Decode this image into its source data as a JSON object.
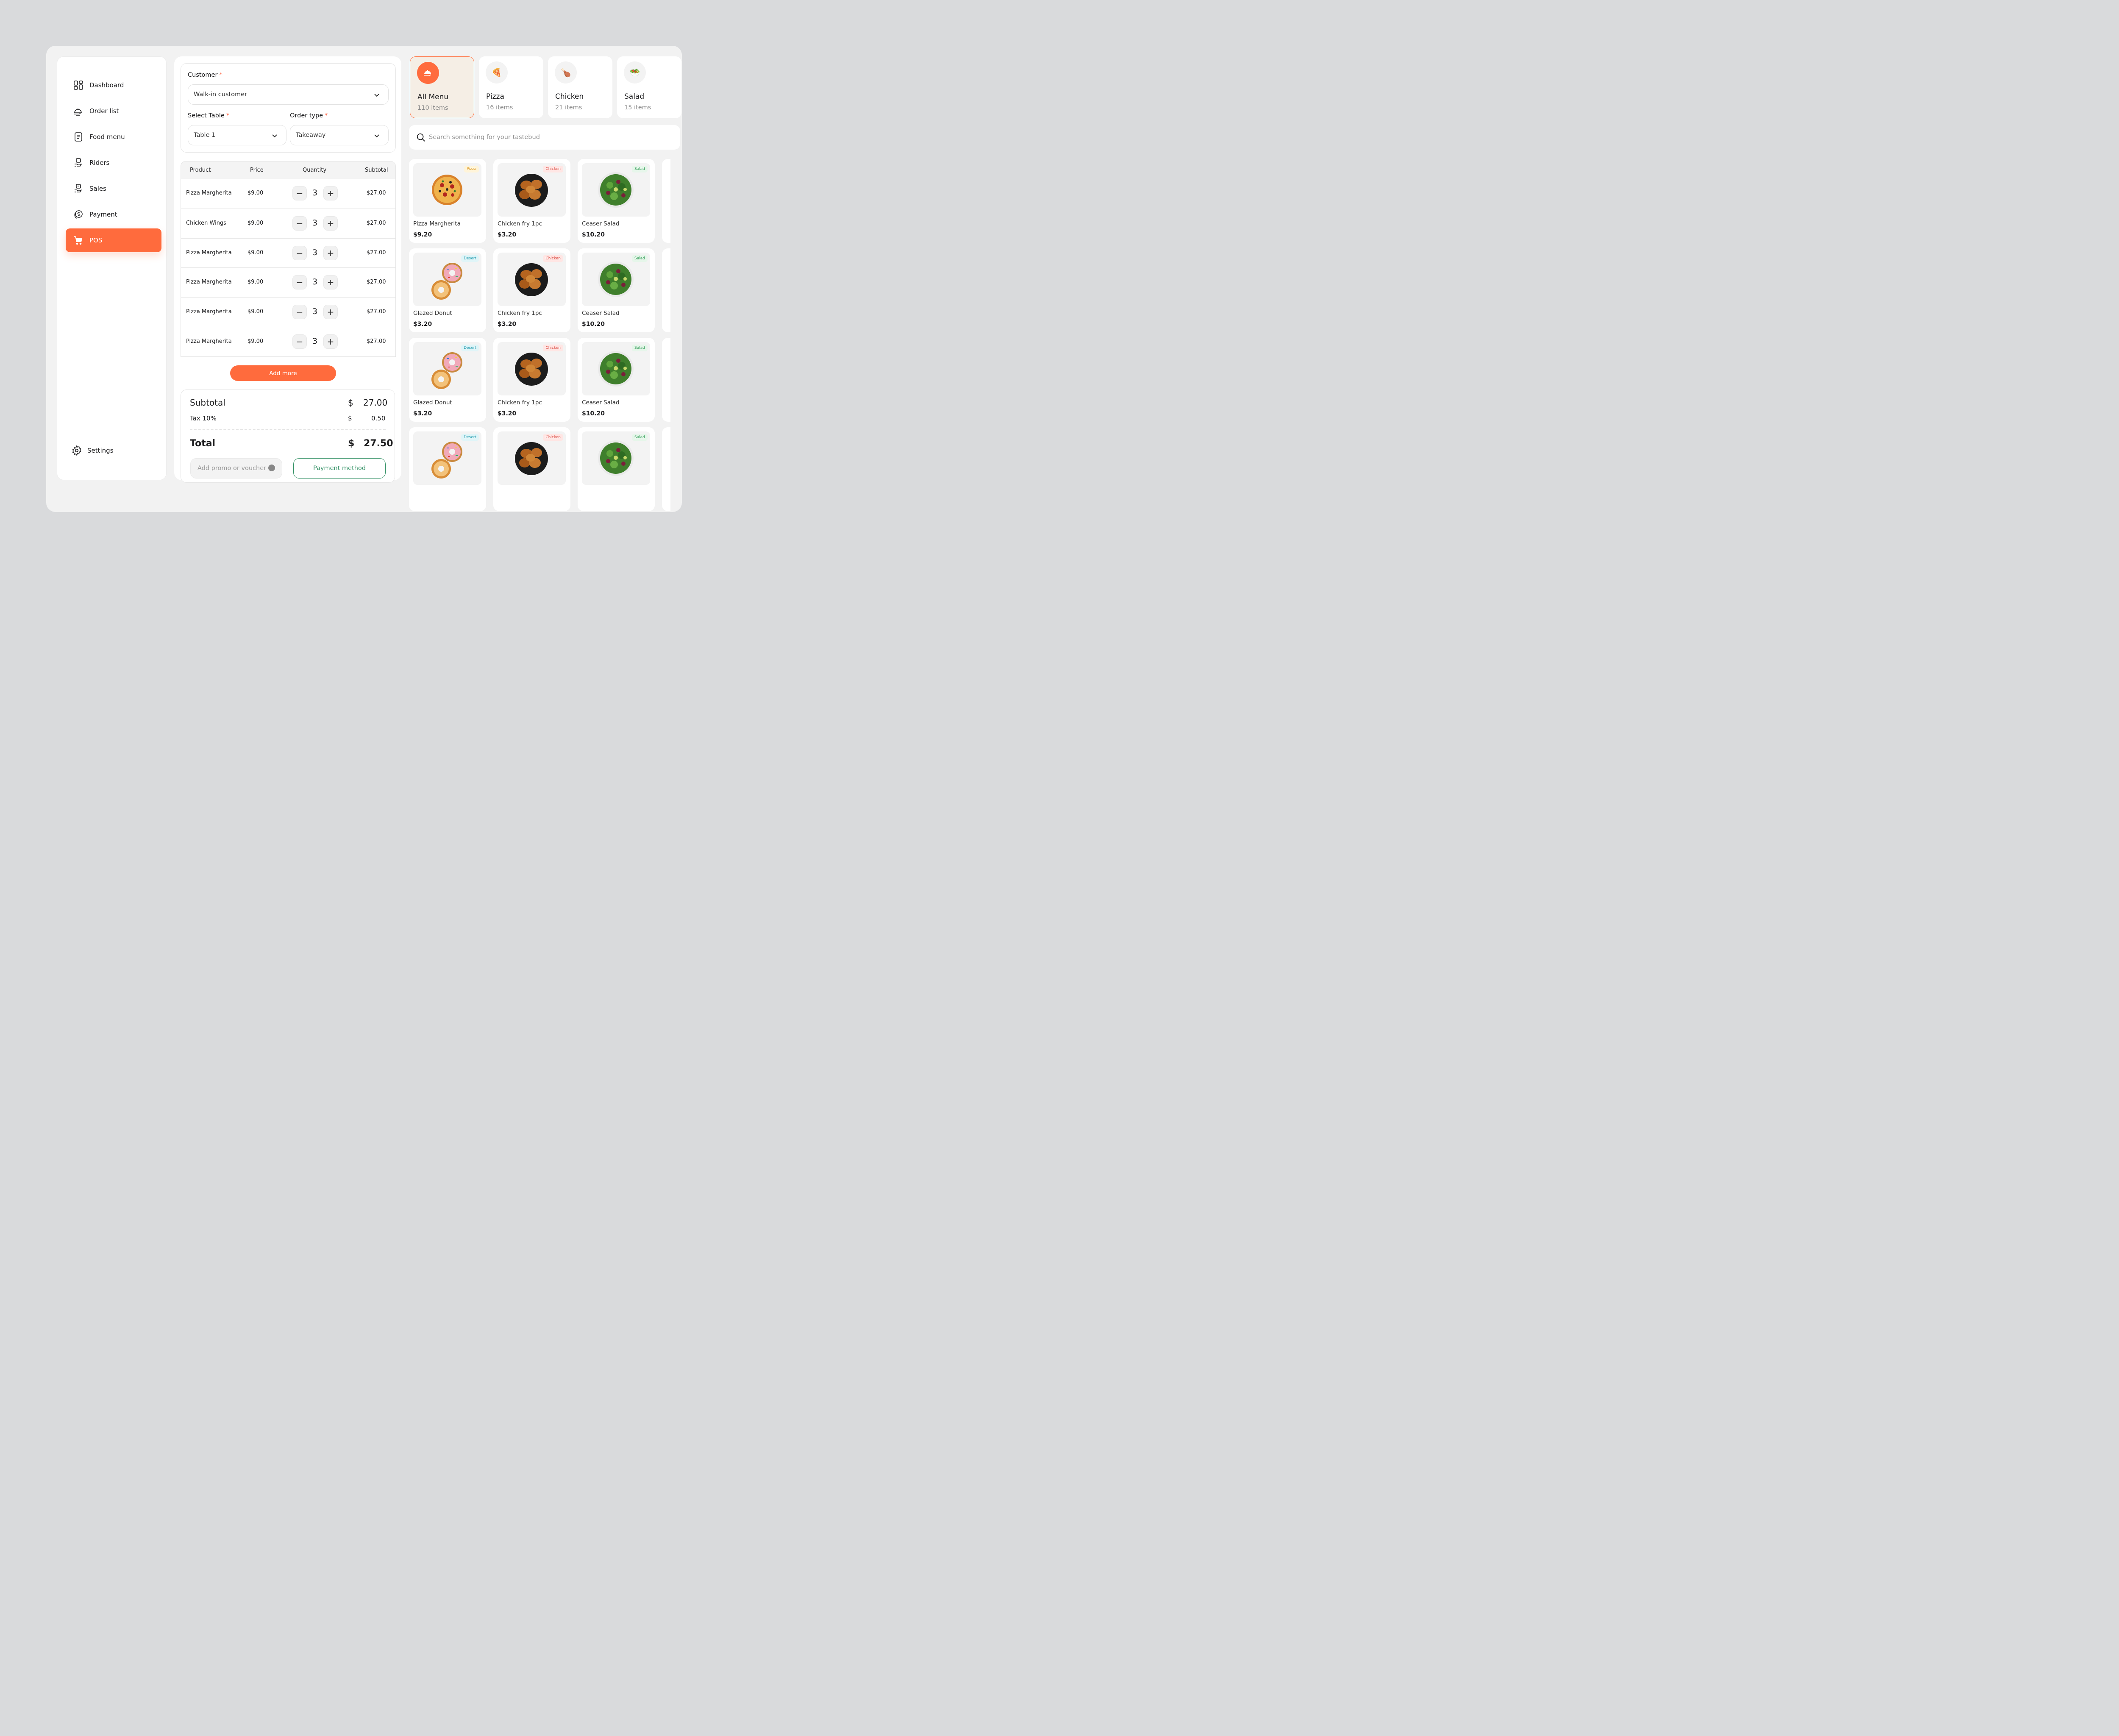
{
  "sidebar": {
    "items": [
      {
        "label": "Dashboard",
        "icon": "dashboard-icon"
      },
      {
        "label": "Order list",
        "icon": "cloche-icon"
      },
      {
        "label": "Food menu",
        "icon": "menu-document-icon"
      },
      {
        "label": "Riders",
        "icon": "rider-hand-icon"
      },
      {
        "label": "Sales",
        "icon": "sales-hand-icon"
      },
      {
        "label": "Payment",
        "icon": "dollar-coin-icon"
      },
      {
        "label": "POS",
        "icon": "cart-icon",
        "active": true
      }
    ],
    "settings_label": "Settings"
  },
  "order": {
    "customer_label": "Customer",
    "customer_value": "Walk-in customer",
    "table_label": "Select Table",
    "table_value": "Table 1",
    "order_type_label": "Order type",
    "order_type_value": "Takeaway",
    "required_mark": "*",
    "columns": [
      "Product",
      "Price",
      "Quantity",
      "Subtotal"
    ],
    "rows": [
      {
        "product": "Pizza Margherita",
        "price": "$9.00",
        "qty": "3",
        "subtotal": "$27.00"
      },
      {
        "product": "Chicken Wings",
        "price": "$9.00",
        "qty": "3",
        "subtotal": "$27.00"
      },
      {
        "product": "Pizza Margherita",
        "price": "$9.00",
        "qty": "3",
        "subtotal": "$27.00"
      },
      {
        "product": "Pizza Margherita",
        "price": "$9.00",
        "qty": "3",
        "subtotal": "$27.00"
      },
      {
        "product": "Pizza Margherita",
        "price": "$9.00",
        "qty": "3",
        "subtotal": "$27.00"
      },
      {
        "product": "Pizza Margherita",
        "price": "$9.00",
        "qty": "3",
        "subtotal": "$27.00"
      }
    ],
    "minus_glyph": "−",
    "plus_glyph": "+",
    "add_more_label": "Add more",
    "summary": {
      "subtotal_label": "Subtotal",
      "subtotal_currency": "$",
      "subtotal_value": "27.00",
      "tax_label": "Tax 10%",
      "tax_currency": "$",
      "tax_value": "0.50",
      "total_label": "Total",
      "total_currency": "$",
      "total_value": "27.50"
    },
    "promo_placeholder": "Add promo or voucher",
    "payment_method_label": "Payment method"
  },
  "categories": [
    {
      "name": "All Menu",
      "count": "110 items",
      "icon": "cloche-icon",
      "active": true
    },
    {
      "name": "Pizza",
      "count": "16 items",
      "icon": "pizza-icon",
      "emoji": "🍕"
    },
    {
      "name": "Chicken",
      "count": "21 items",
      "icon": "chicken-icon",
      "emoji": "🍗"
    },
    {
      "name": "Salad",
      "count": "15 items",
      "icon": "salad-icon",
      "emoji": "🥗"
    }
  ],
  "search": {
    "placeholder": "Search something for your tastebud"
  },
  "products": [
    {
      "name": "Pizza Margherita",
      "price": "$9.20",
      "tag": "Pizza",
      "kind": "pizza"
    },
    {
      "name": "Chicken fry 1pc",
      "price": "$3.20",
      "tag": "Chicken",
      "kind": "chicken"
    },
    {
      "name": "Ceaser Salad",
      "price": "$10.20",
      "tag": "Salad",
      "kind": "salad"
    },
    {
      "name": "Glazed Donut",
      "price": "$3.20",
      "tag": "Desert",
      "kind": "donut"
    },
    {
      "name": "Chicken fry 1pc",
      "price": "$3.20",
      "tag": "Chicken",
      "kind": "chicken"
    },
    {
      "name": "Ceaser Salad",
      "price": "$10.20",
      "tag": "Salad",
      "kind": "salad"
    },
    {
      "name": "Glazed Donut",
      "price": "$3.20",
      "tag": "Desert",
      "kind": "donut"
    },
    {
      "name": "Chicken fry 1pc",
      "price": "$3.20",
      "tag": "Chicken",
      "kind": "chicken"
    },
    {
      "name": "Ceaser Salad",
      "price": "$10.20",
      "tag": "Salad",
      "kind": "salad"
    },
    {
      "name": "",
      "price": "",
      "tag": "Desert",
      "kind": "donut"
    },
    {
      "name": "",
      "price": "",
      "tag": "Chicken",
      "kind": "chicken"
    },
    {
      "name": "",
      "price": "",
      "tag": "Salad",
      "kind": "salad"
    }
  ],
  "colors": {
    "accent": "#ff6b3d",
    "payment_green": "#2f8f62"
  }
}
